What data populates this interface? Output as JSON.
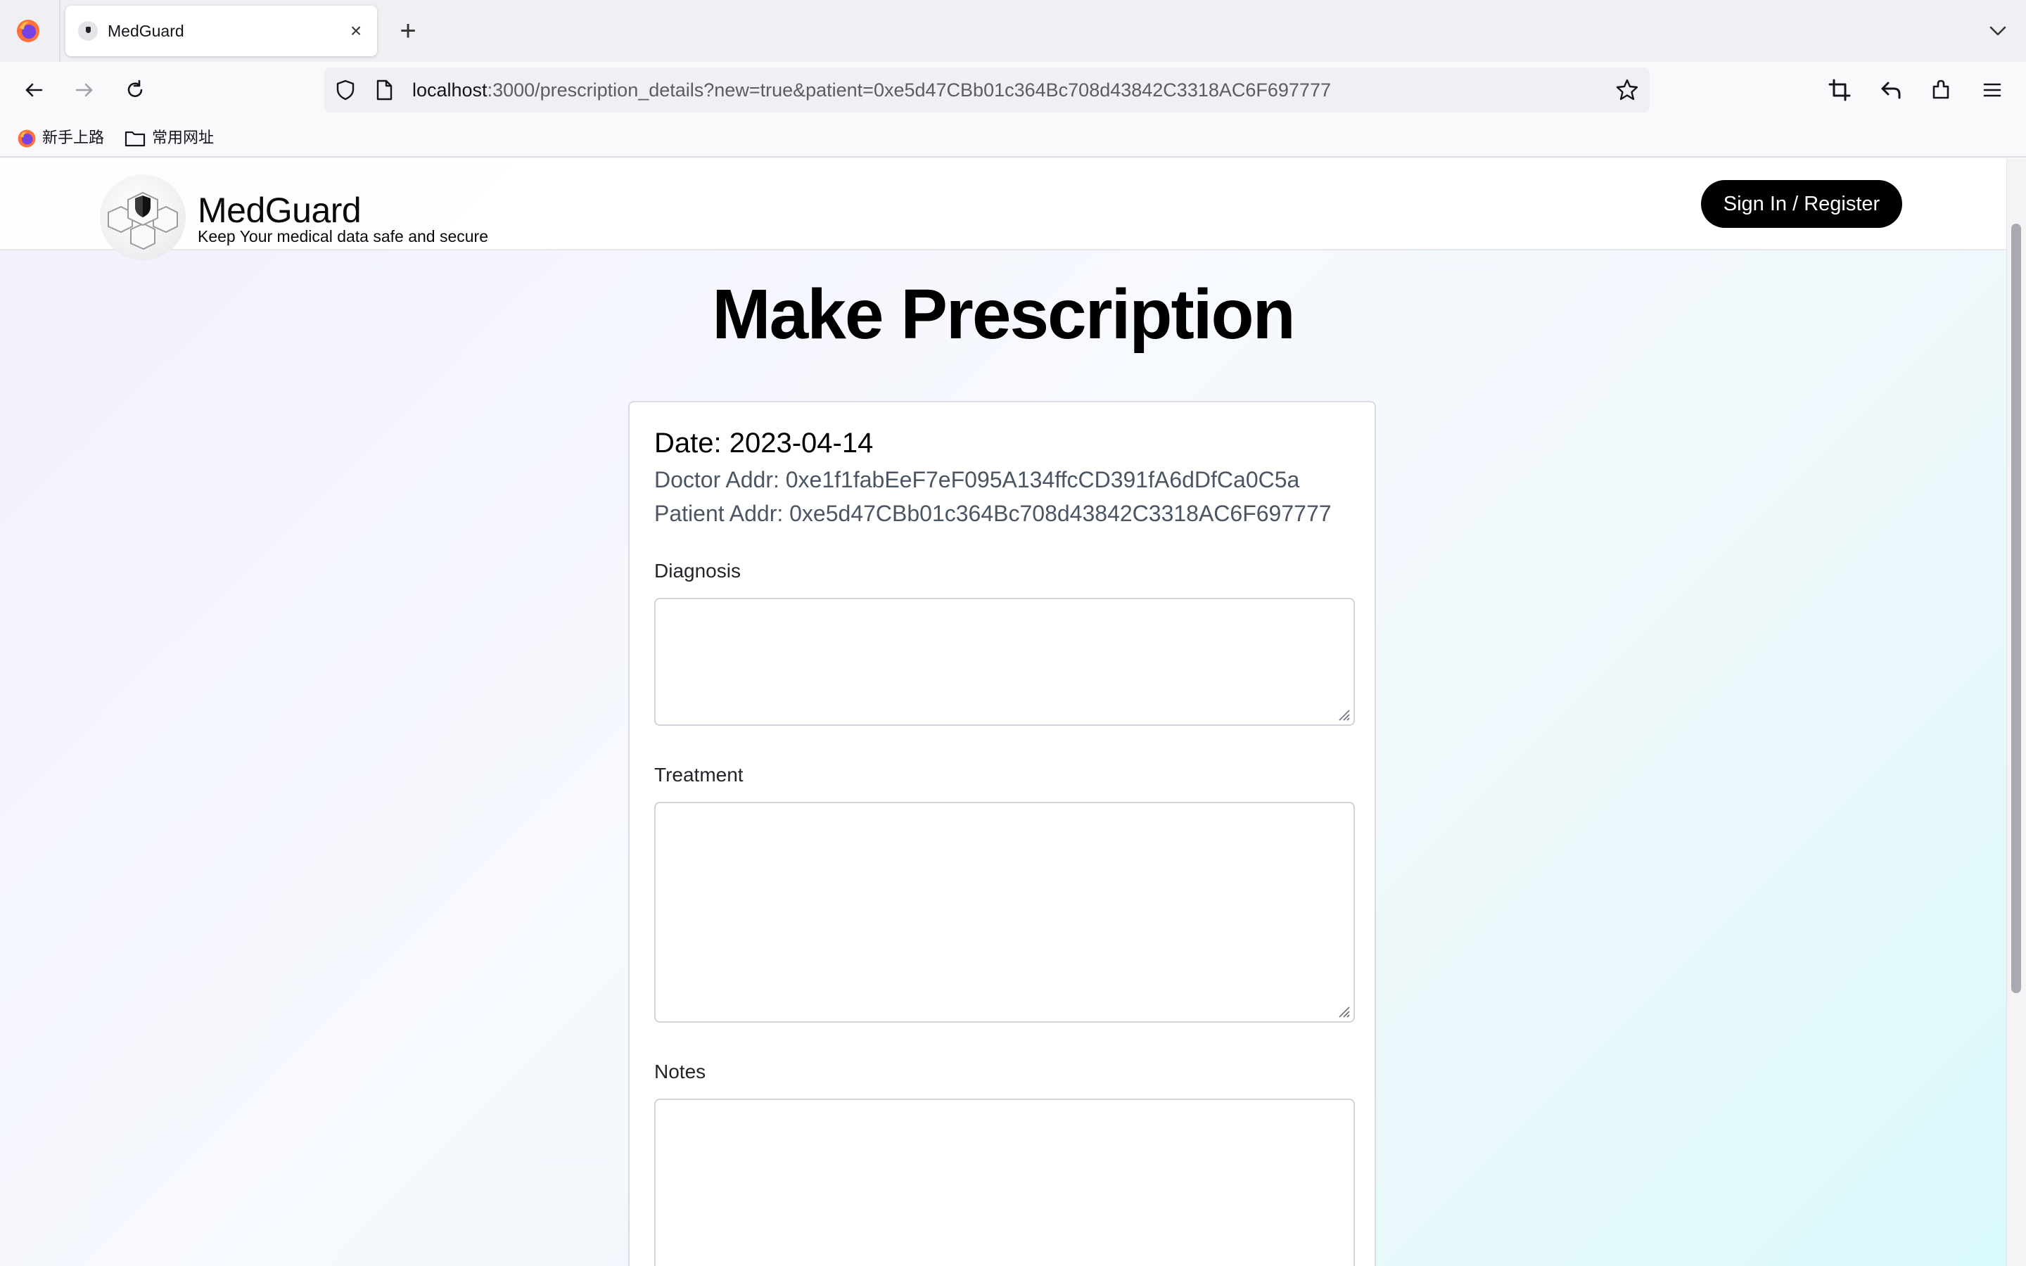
{
  "browser": {
    "tab_title": "MedGuard",
    "url_host": "localhost",
    "url_rest": ":3000/prescription_details?new=true&patient=0xe5d47CBb01c364Bc708d43842C3318AC6F697777",
    "bookmarks": [
      {
        "label": "新手上路",
        "icon": "firefox-icon"
      },
      {
        "label": "常用网址",
        "icon": "folder-icon"
      }
    ]
  },
  "site": {
    "brand_name": "MedGuard",
    "tagline": "Keep Your medical data safe and secure",
    "signin_label": "Sign In / Register"
  },
  "page": {
    "title": "Make Prescription"
  },
  "prescription": {
    "date": "Date: 2023-04-14",
    "doctor_addr": "Doctor Addr: 0xe1f1fabEeF7eF095A134ffcCD391fA6dDfCa0C5a",
    "patient_addr": "Patient Addr: 0xe5d47CBb01c364Bc708d43842C3318AC6F697777",
    "fields": [
      {
        "label": "Diagnosis",
        "value": ""
      },
      {
        "label": "Treatment",
        "value": ""
      },
      {
        "label": "Notes",
        "value": ""
      }
    ]
  }
}
